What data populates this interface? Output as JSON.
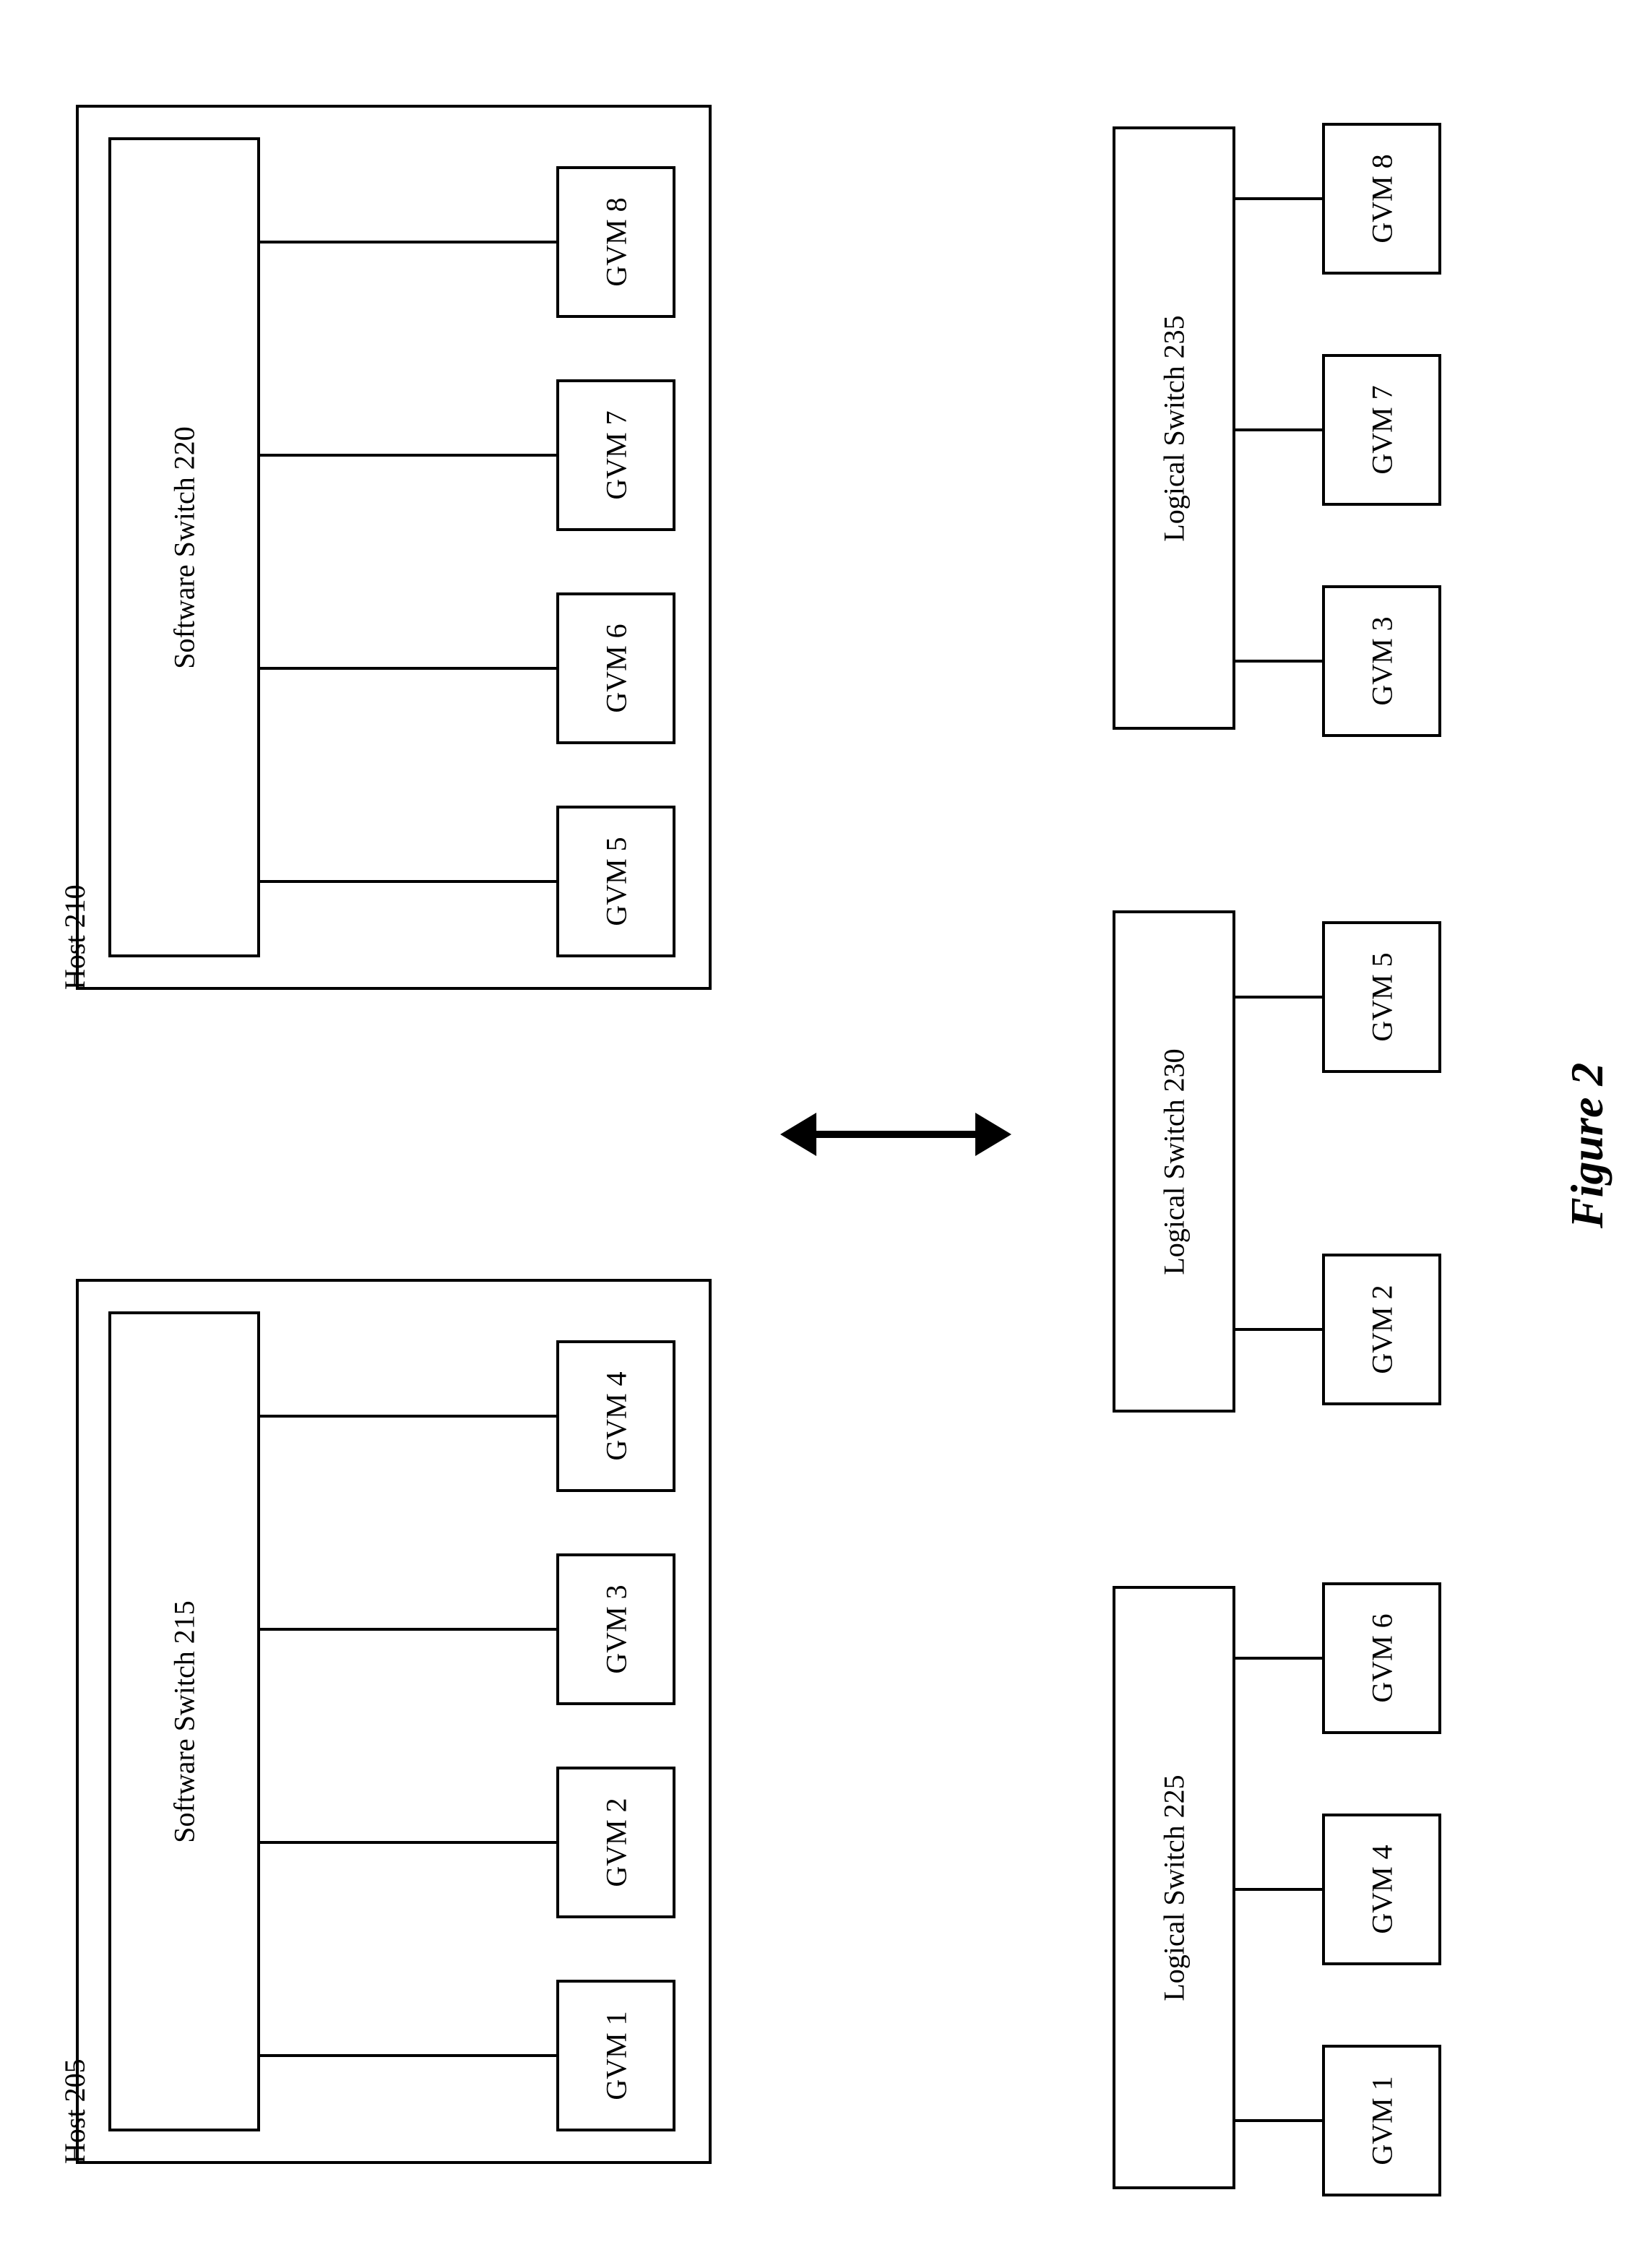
{
  "figure": {
    "caption": "Figure 2"
  },
  "hosts": {
    "a": {
      "label": "Host 205",
      "switch": "Software Switch 215",
      "gvms": [
        "GVM 1",
        "GVM 2",
        "GVM 3",
        "GVM 4"
      ]
    },
    "b": {
      "label": "Host 210",
      "switch": "Software Switch 220",
      "gvms": [
        "GVM 5",
        "GVM 6",
        "GVM 7",
        "GVM 8"
      ]
    }
  },
  "logical_switches": {
    "a": {
      "switch": "Logical Switch 225",
      "gvms": [
        "GVM 1",
        "GVM 4",
        "GVM 6"
      ]
    },
    "b": {
      "switch": "Logical Switch 230",
      "gvms": [
        "GVM 2",
        "GVM 5"
      ]
    },
    "c": {
      "switch": "Logical Switch 235",
      "gvms": [
        "GVM 3",
        "GVM 7",
        "GVM 8"
      ]
    }
  }
}
